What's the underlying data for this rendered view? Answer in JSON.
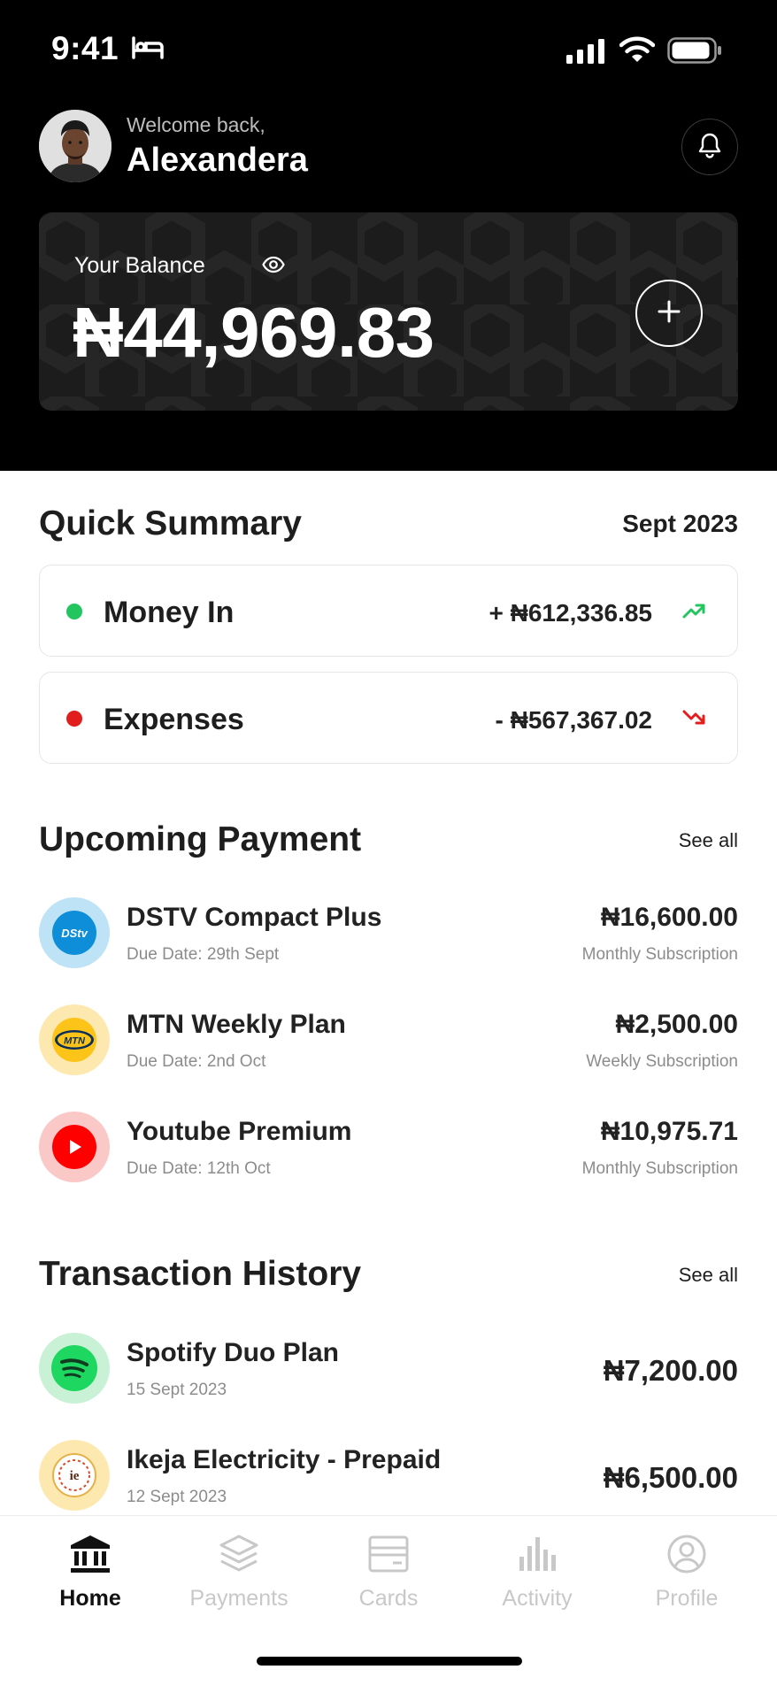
{
  "status_bar": {
    "time": "9:41"
  },
  "header": {
    "welcome": "Welcome back,",
    "user_name": "Alexandera"
  },
  "balance": {
    "label": "Your Balance",
    "amount": "₦44,969.83"
  },
  "quick_summary": {
    "title": "Quick Summary",
    "period": "Sept 2023",
    "money_in": {
      "label": "Money In",
      "amount": "+ ₦612,336.85",
      "color": "#22c55e"
    },
    "expenses": {
      "label": "Expenses",
      "amount": "- ₦567,367.02",
      "color": "#e11d1d"
    }
  },
  "upcoming": {
    "title": "Upcoming Payment",
    "see_all": "See all",
    "items": [
      {
        "name": "DSTV Compact Plus",
        "due": "Due Date: 29th Sept",
        "amount": "₦16,600.00",
        "type": "Monthly Subscription",
        "icon": "dstv-logo-icon",
        "logo_text": "DStv"
      },
      {
        "name": "MTN Weekly Plan",
        "due": "Due Date: 2nd Oct",
        "amount": "₦2,500.00",
        "type": "Weekly Subscription",
        "icon": "mtn-logo-icon",
        "logo_text": "MTN"
      },
      {
        "name": "Youtube Premium",
        "due": "Due Date: 12th Oct",
        "amount": "₦10,975.71",
        "type": "Monthly Subscription",
        "icon": "youtube-logo-icon"
      }
    ]
  },
  "history": {
    "title": "Transaction History",
    "see_all": "See all",
    "items": [
      {
        "name": "Spotify Duo Plan",
        "date": "15 Sept 2023",
        "amount": "₦7,200.00",
        "icon": "spotify-logo-icon"
      },
      {
        "name": "Ikeja Electricity - Prepaid",
        "date": "12 Sept 2023",
        "amount": "₦6,500.00",
        "icon": "ikeja-electric-logo-icon",
        "logo_text": "ie"
      }
    ]
  },
  "nav": {
    "items": [
      {
        "label": "Home",
        "icon": "bank-icon",
        "active": true
      },
      {
        "label": "Payments",
        "icon": "layers-icon"
      },
      {
        "label": "Cards",
        "icon": "card-icon"
      },
      {
        "label": "Activity",
        "icon": "bar-chart-icon"
      },
      {
        "label": "Profile",
        "icon": "user-circle-icon"
      }
    ]
  }
}
